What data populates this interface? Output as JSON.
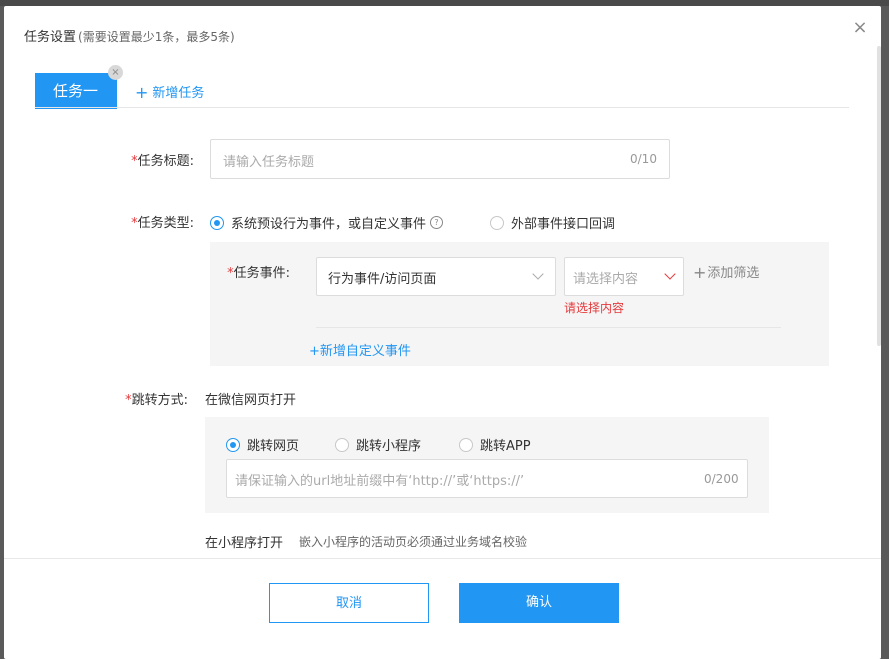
{
  "dialog": {
    "title": "任务设置",
    "subtitle": "(需要设置最少1条，最多5条)",
    "close_symbol": "×"
  },
  "tabs": {
    "active_label": "任务一",
    "remove_symbol": "×",
    "add_label": "新增任务"
  },
  "task_title": {
    "label": "任务标题:",
    "placeholder": "请输入任务标题",
    "count": "0/10"
  },
  "task_type": {
    "label": "任务类型:",
    "options": [
      {
        "label": "系统预设行为事件，或自定义事件",
        "selected": true
      },
      {
        "label": "外部事件接口回调",
        "selected": false
      }
    ],
    "help_symbol": "?"
  },
  "task_event": {
    "label": "任务事件:",
    "event_value": "行为事件/访问页面",
    "content_placeholder": "请选择内容",
    "add_filter": "添加筛选",
    "error": "请选择内容",
    "add_custom": "+新增自定义事件"
  },
  "jump": {
    "label": "跳转方式:",
    "open_in_wechat": "在微信网页打开",
    "options": [
      {
        "label": "跳转网页",
        "selected": true
      },
      {
        "label": "跳转小程序",
        "selected": false
      },
      {
        "label": "跳转APP",
        "selected": false
      }
    ],
    "url_placeholder": "请保证输入的url地址前缀中有‘http://’或‘https://’",
    "url_count": "0/200",
    "open_in_miniprogram": "在小程序打开",
    "miniprogram_hint": "嵌入小程序的活动页必须通过业务域名校验"
  },
  "footer": {
    "cancel": "取消",
    "confirm": "确认"
  },
  "colors": {
    "primary": "#2196f3",
    "required": "#e5393c",
    "panel_bg": "#f5f5f5"
  }
}
